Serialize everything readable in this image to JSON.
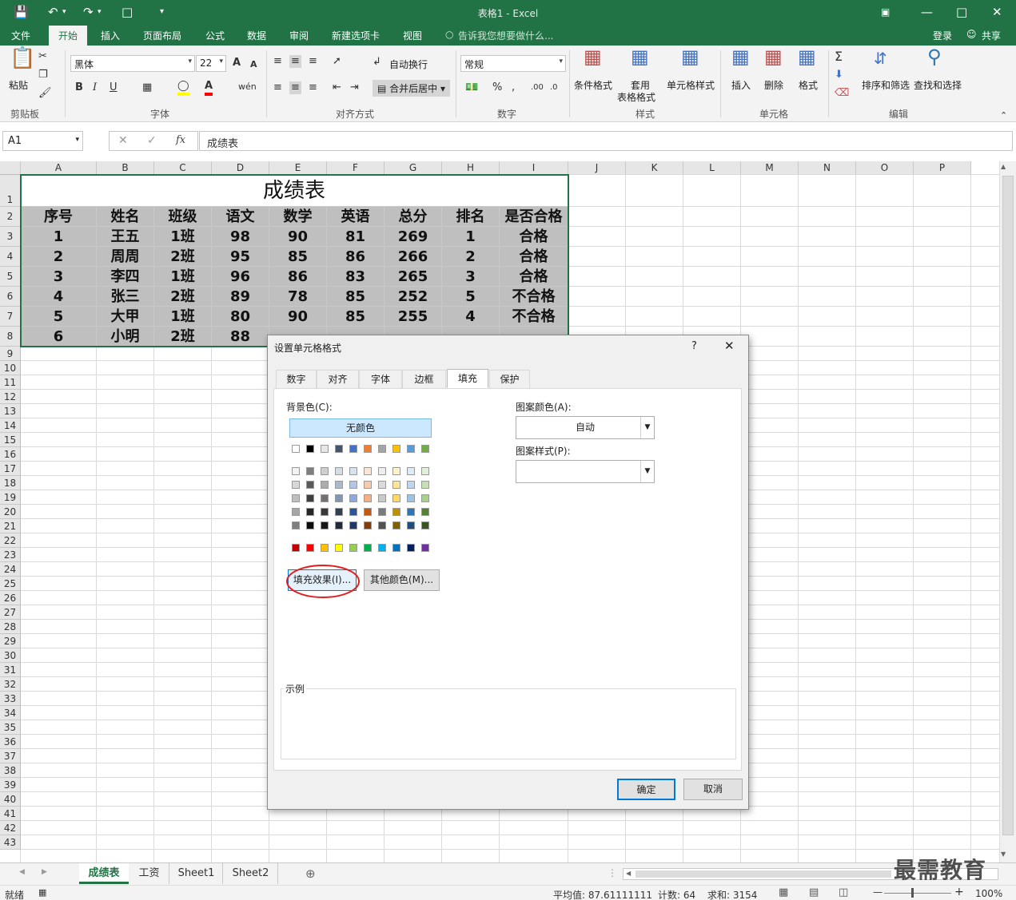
{
  "titlebar": {
    "title": "表格1 - Excel"
  },
  "menu": {
    "items": [
      "文件",
      "开始",
      "插入",
      "页面布局",
      "公式",
      "数据",
      "审阅",
      "新建选项卡",
      "视图"
    ],
    "tell_me": "告诉我您想要做什么...",
    "login": "登录",
    "share": "共享"
  },
  "ribbon": {
    "paste": "粘贴",
    "font_name": "黑体",
    "font_size": "22",
    "wrap_text": "自动换行",
    "merge_center": "合并后居中",
    "number_format": "常规",
    "cond_format": "条件格式",
    "table_format_1": "套用",
    "table_format_2": "表格格式",
    "cell_style": "单元格样式",
    "insert": "插入",
    "delete": "删除",
    "format": "格式",
    "sort_filter": "排序和筛选",
    "find_select": "查找和选择",
    "groups": {
      "clipboard": "剪贴板",
      "font": "字体",
      "align": "对齐方式",
      "number": "数字",
      "style": "样式",
      "cells": "单元格",
      "edit": "编辑"
    }
  },
  "formula_bar": {
    "name_box": "A1",
    "content": "成绩表"
  },
  "grid": {
    "columns": [
      "A",
      "B",
      "C",
      "D",
      "E",
      "F",
      "G",
      "H",
      "I",
      "J",
      "K",
      "L",
      "M",
      "N",
      "O",
      "P"
    ],
    "title": "成绩表",
    "headers": [
      "序号",
      "姓名",
      "班级",
      "语文",
      "数学",
      "英语",
      "总分",
      "排名",
      "是否合格"
    ],
    "rows": [
      [
        "1",
        "王五",
        "1班",
        "98",
        "90",
        "81",
        "269",
        "1",
        "合格"
      ],
      [
        "2",
        "周周",
        "2班",
        "95",
        "85",
        "86",
        "266",
        "2",
        "合格"
      ],
      [
        "3",
        "李四",
        "1班",
        "96",
        "86",
        "83",
        "265",
        "3",
        "合格"
      ],
      [
        "4",
        "张三",
        "2班",
        "89",
        "78",
        "85",
        "252",
        "5",
        "不合格"
      ],
      [
        "5",
        "大甲",
        "1班",
        "80",
        "90",
        "85",
        "255",
        "4",
        "不合格"
      ],
      [
        "6",
        "小明",
        "2班",
        "88",
        "",
        "",
        "",
        "",
        ""
      ]
    ]
  },
  "sheets": {
    "tabs": [
      "成绩表",
      "工资",
      "Sheet1",
      "Sheet2"
    ],
    "active": "成绩表"
  },
  "status": {
    "ready": "就绪",
    "average": "平均值: 87.61111111",
    "count": "计数: 64",
    "sum": "求和: 3154",
    "zoom": "100%"
  },
  "watermark": "最需教育",
  "dialog": {
    "title": "设置单元格格式",
    "help": "?",
    "tabs": [
      "数字",
      "对齐",
      "字体",
      "边框",
      "填充",
      "保护"
    ],
    "active_tab": "填充",
    "bg_color_label": "背景色(C):",
    "no_color": "无颜色",
    "fill_effects": "填充效果(I)...",
    "more_colors": "其他颜色(M)...",
    "pattern_color_label": "图案颜色(A):",
    "pattern_color_value": "自动",
    "pattern_style_label": "图案样式(P):",
    "sample_label": "示例",
    "ok": "确定",
    "cancel": "取消",
    "theme_colors_top": [
      "#ffffff",
      "#000000",
      "#e7e6e6",
      "#44546a",
      "#4472c4",
      "#ed7d31",
      "#a5a5a5",
      "#ffc000",
      "#5b9bd5",
      "#70ad47"
    ],
    "theme_shades": [
      [
        "#f2f2f2",
        "#7f7f7f",
        "#d0cece",
        "#d6dce4",
        "#d9e2f3",
        "#fbe5d5",
        "#ededed",
        "#fff2cc",
        "#deeaf6",
        "#e2efd9"
      ],
      [
        "#d8d8d8",
        "#595959",
        "#aeabab",
        "#adb9ca",
        "#b4c6e7",
        "#f7caac",
        "#dbdbdb",
        "#fee599",
        "#bdd7ee",
        "#c5e0b3"
      ],
      [
        "#bfbfbf",
        "#3f3f3f",
        "#757070",
        "#8496b0",
        "#8eaadb",
        "#f4b083",
        "#c9c9c9",
        "#ffd965",
        "#9cc3e5",
        "#a8d08d"
      ],
      [
        "#a5a5a5",
        "#262626",
        "#3a3838",
        "#323f4f",
        "#2f5496",
        "#c45911",
        "#7b7b7b",
        "#bf9000",
        "#2e75b5",
        "#538135"
      ],
      [
        "#7f7f7f",
        "#0c0c0c",
        "#171616",
        "#222a35",
        "#1f3864",
        "#833c0b",
        "#525252",
        "#7f6000",
        "#1e4e79",
        "#375623"
      ]
    ],
    "standard_colors": [
      "#c00000",
      "#ff0000",
      "#ffc000",
      "#ffff00",
      "#92d050",
      "#00b050",
      "#00b0f0",
      "#0070c0",
      "#002060",
      "#7030a0"
    ]
  }
}
